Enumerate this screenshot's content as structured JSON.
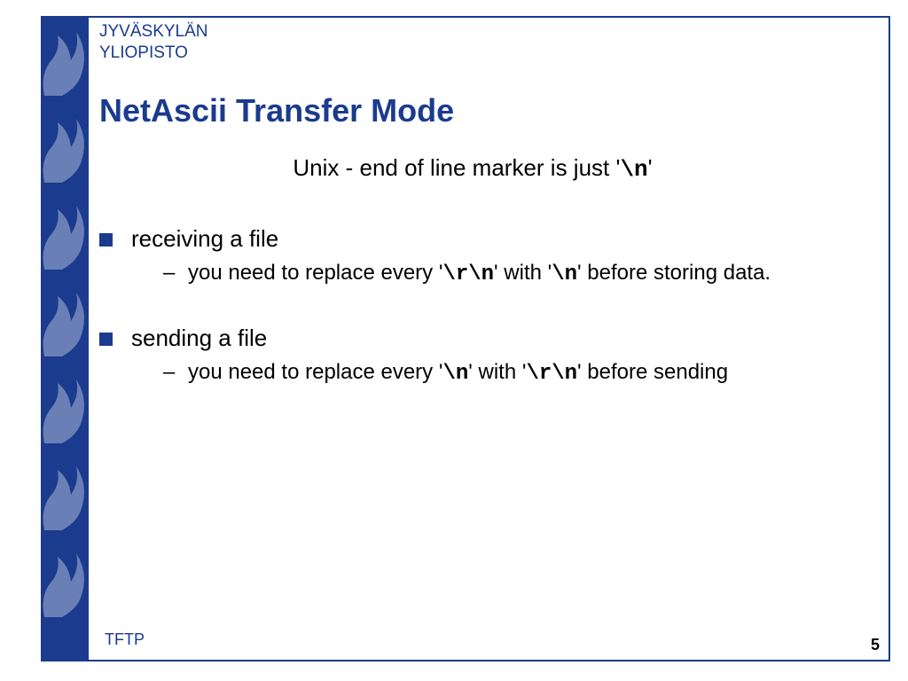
{
  "org": {
    "line1": "JYVÄSKYLÄN",
    "line2": "YLIOPISTO"
  },
  "title": "NetAscii Transfer Mode",
  "subtitle": {
    "pre": "Unix - end of line marker is just '",
    "code": "\\n",
    "post": "'"
  },
  "bullets": [
    {
      "text": "receiving a file",
      "sub": {
        "p1": " you need to replace every '",
        "c1": "\\r\\n",
        "p2": "' with '",
        "c2": "\\n",
        "p3": "'  before storing data."
      }
    },
    {
      "text": "sending a file",
      "sub": {
        "p1": "you need to replace every '",
        "c1": "\\n",
        "p2": "' with '",
        "c2": "\\r\\n",
        "p3": "' before sending"
      }
    }
  ],
  "footer": "TFTP",
  "page": "5"
}
